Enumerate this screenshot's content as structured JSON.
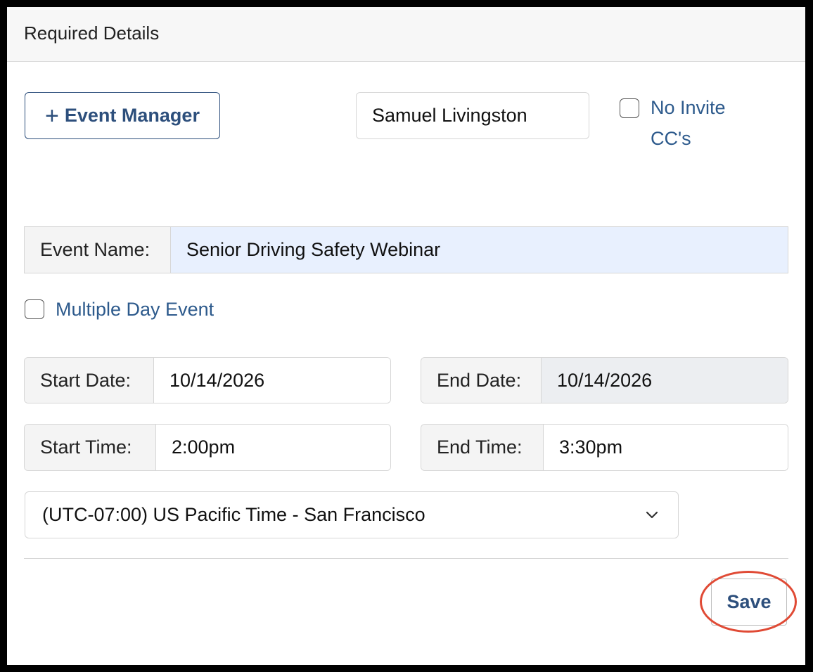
{
  "header": {
    "title": "Required Details"
  },
  "event_manager": {
    "button_label": "Event Manager",
    "button_icon": "plus-icon",
    "selected_value": "Samuel Livingston"
  },
  "no_invite_cc": {
    "label": "No Invite CC's",
    "checked": false
  },
  "event_name": {
    "label": "Event Name:",
    "value": "Senior Driving Safety Webinar"
  },
  "multiple_day": {
    "label": "Multiple Day Event",
    "checked": false
  },
  "start_date": {
    "label": "Start Date:",
    "value": "10/14/2026"
  },
  "end_date": {
    "label": "End Date:",
    "value": "10/14/2026"
  },
  "start_time": {
    "label": "Start Time:",
    "value": "2:00pm"
  },
  "end_time": {
    "label": "End Time:",
    "value": "3:30pm"
  },
  "timezone": {
    "selected": "(UTC-07:00) US Pacific Time - San Francisco"
  },
  "actions": {
    "save_label": "Save"
  },
  "colors": {
    "accent": "#2d4f7c",
    "link": "#2d5a8c",
    "autofill_bg": "#e8f0fe",
    "disabled_bg": "#eceef1",
    "highlight": "#e04a35"
  }
}
